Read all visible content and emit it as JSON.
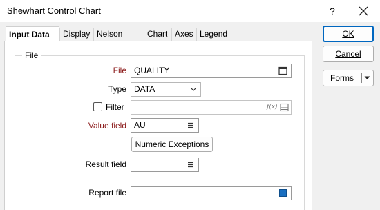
{
  "window": {
    "title": "Shewhart Control Chart",
    "help_glyph": "?"
  },
  "tabs": [
    {
      "label": "Input Data",
      "active": true
    },
    {
      "label": "Display"
    },
    {
      "label": "Nelson Rules"
    },
    {
      "label": "Chart"
    },
    {
      "label": "Axes"
    },
    {
      "label": "Legend"
    }
  ],
  "file_group": {
    "legend": "File"
  },
  "form": {
    "file_label": "File",
    "file_value": "QUALITY",
    "type_label": "Type",
    "type_value": "DATA",
    "filter_label": "Filter",
    "filter_value": "",
    "filter_fx": "f(x)",
    "value_field_label": "Value field",
    "value_field_value": "AU",
    "numeric_exceptions_label": "Numeric Exceptions ...",
    "result_field_label": "Result field",
    "result_field_value": "",
    "report_file_label": "Report file",
    "report_file_value": ""
  },
  "side_buttons": {
    "ok": "OK",
    "cancel": "Cancel",
    "forms": "Forms"
  },
  "colors": {
    "required_label": "#8b1a1a",
    "accent": "#0067c0"
  }
}
